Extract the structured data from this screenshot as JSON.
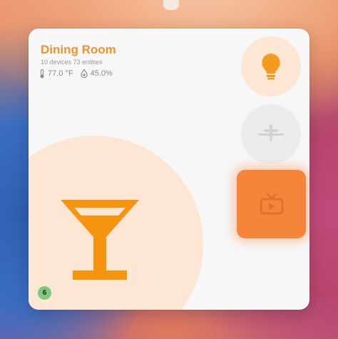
{
  "room": {
    "name": "Dining Room",
    "summary": "10 devices 73 entities",
    "temperature": "77.0 °F",
    "humidity": "45.0%"
  },
  "badge": {
    "count": "6",
    "color": "#7fc97f"
  },
  "devices": [
    {
      "name": "light",
      "icon": "lightbulb-icon",
      "state": "on",
      "color": "#f49a1f"
    },
    {
      "name": "fan",
      "icon": "ceiling-fan-icon",
      "state": "off",
      "color": "#d2d2d2"
    },
    {
      "name": "tv",
      "icon": "television-icon",
      "state": "on",
      "color": "#f5853b"
    }
  ],
  "scene_icon": "cocktail-glass-icon",
  "colors": {
    "accent": "#f0922a",
    "accent_light": "#fde6d4",
    "card_bg": "#f7f7f7"
  }
}
